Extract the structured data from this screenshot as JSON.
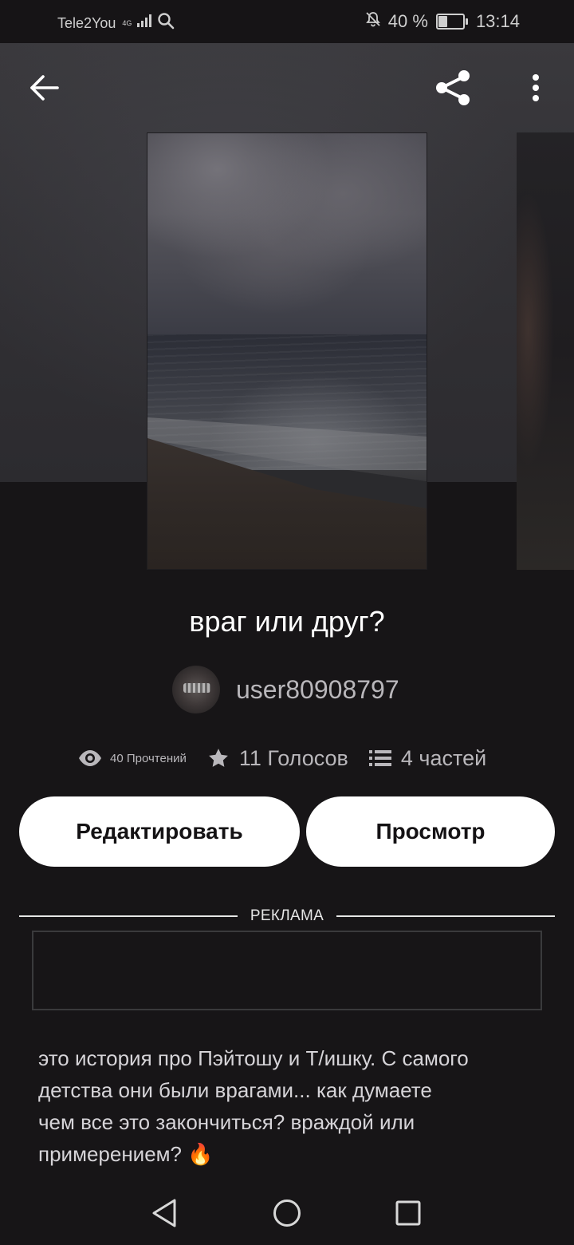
{
  "status_bar": {
    "carrier": "Tele2You",
    "network": "4G",
    "battery_text": "40 %",
    "battery_level": 0.4,
    "time": "13:14"
  },
  "header": {
    "back_icon": "arrow-left-icon",
    "share_icon": "share-icon",
    "more_icon": "more-vertical-icon"
  },
  "story": {
    "title": "враг или друг?",
    "author": "user80908797",
    "stats": {
      "reads": "40 Прочтений",
      "votes": "11 Голосов",
      "parts": "4 частей"
    },
    "description": "это история про Пэйтошу и Т/ишку. С самого\nдетства они были врагами... как думаете\nчем все это закончиться? враждой или\nпримерением? 🔥"
  },
  "actions": {
    "edit_label": "Редактировать",
    "view_label": "Просмотр"
  },
  "ad": {
    "label": "РЕКЛАМА"
  },
  "nav": {
    "back_icon": "nav-back-icon",
    "home_icon": "nav-home-icon",
    "recent_icon": "nav-recent-icon"
  },
  "colors": {
    "background": "#171517",
    "header_bg": "#333236",
    "button_bg": "#ffffff",
    "button_text": "#141214",
    "muted_text": "#b9b7bb"
  }
}
